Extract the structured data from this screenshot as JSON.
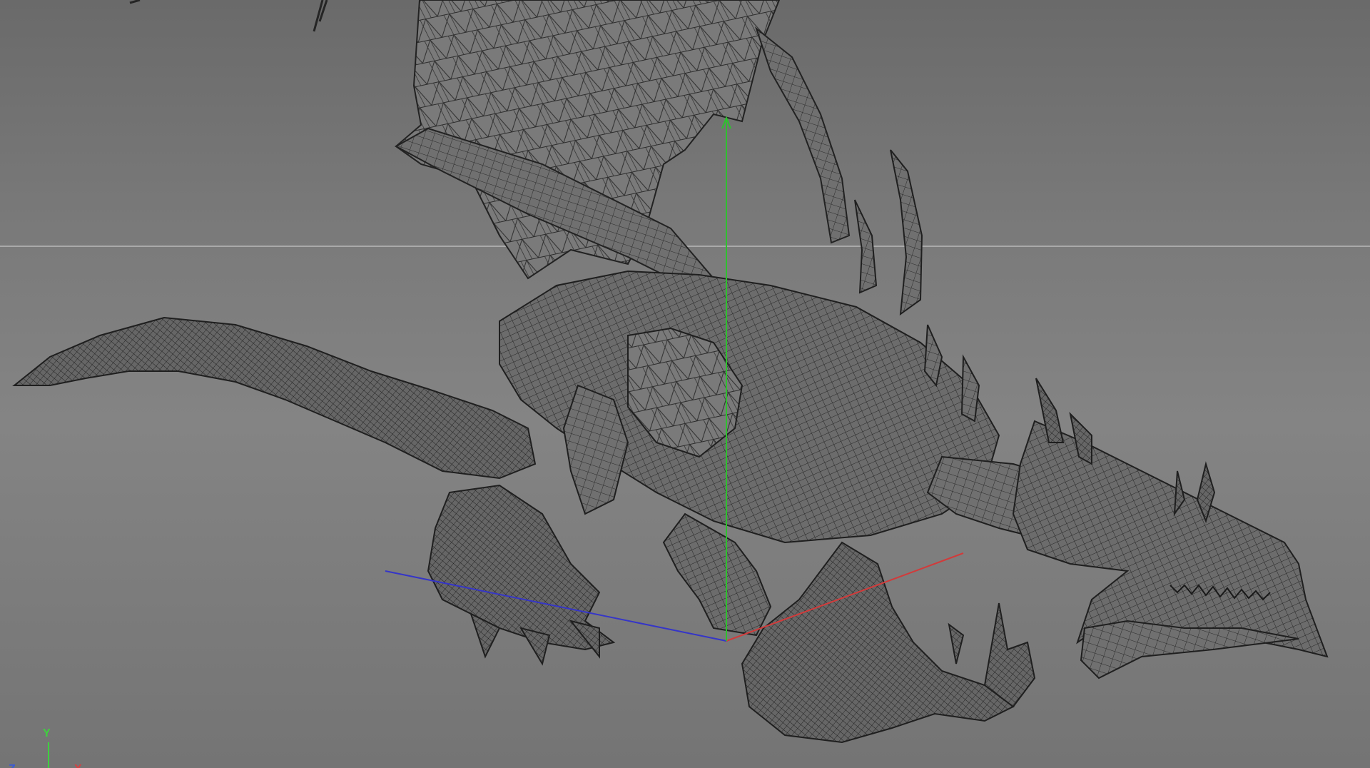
{
  "viewport": {
    "background_top": "#6a6a6a",
    "background_bottom": "#747474",
    "horizon_color": "#a9a9a9",
    "wire_color": "#242424",
    "mesh_fill": "#6f6f6f"
  },
  "model": {
    "name_icon": "dragon-wireframe-mesh"
  },
  "pivot_gizmo": {
    "x_axis_color": "#d23a3a",
    "y_axis_color": "#2fc02f",
    "z_axis_color": "#3535c8"
  },
  "view_axis_indicator": {
    "y_label": "Y",
    "z_label": "Z",
    "x_label": "X",
    "y_color": "#3fd03f",
    "z_color": "#3a5ad8",
    "x_color": "#d84040"
  }
}
